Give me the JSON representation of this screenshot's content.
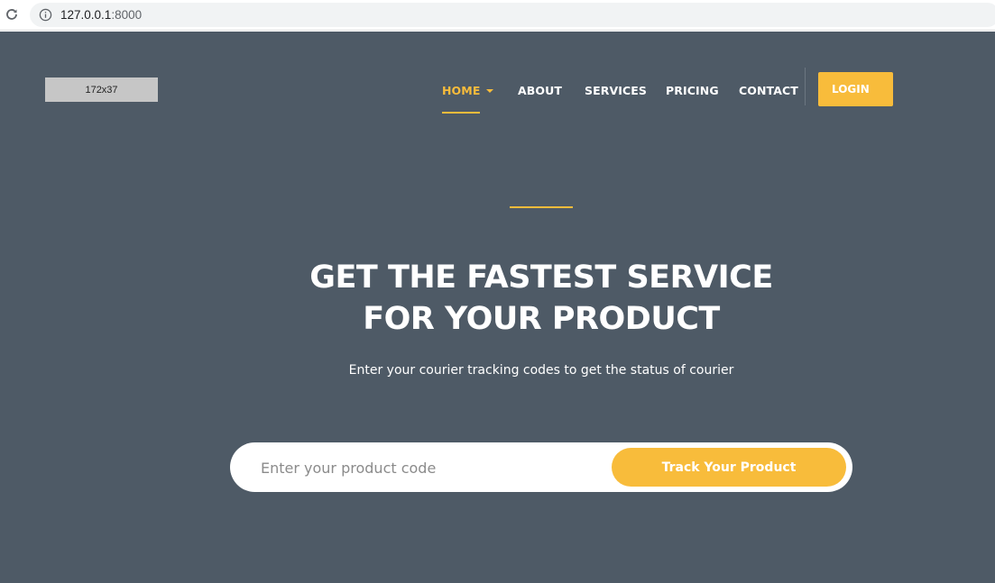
{
  "browser": {
    "url_host": "127.0.0.1",
    "url_port": ":8000"
  },
  "logo": {
    "placeholder_text": "172x37"
  },
  "nav": {
    "items": [
      {
        "label": "HOME"
      },
      {
        "label": "ABOUT"
      },
      {
        "label": "SERVICES"
      },
      {
        "label": "PRICING"
      },
      {
        "label": "CONTACT"
      }
    ],
    "login_label": "LOGIN"
  },
  "hero": {
    "title_line1": "GET THE FASTEST SERVICE",
    "title_line2": "FOR YOUR PRODUCT",
    "subtitle": "Enter your courier tracking codes to get the status of courier"
  },
  "track_form": {
    "placeholder": "Enter your product code",
    "value": "",
    "button_label": "Track Your Product"
  },
  "colors": {
    "background": "#4e5a66",
    "accent": "#f8bc3b",
    "text": "#ffffff"
  },
  "icons": [
    "reload-icon",
    "info-icon",
    "chevron-down-icon"
  ]
}
